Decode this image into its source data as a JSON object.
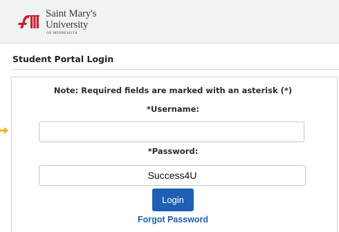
{
  "header": {
    "logo": {
      "icon": "university-crest-icon",
      "line1": "Saint Mary's",
      "line2": "University",
      "line3": "OF MINNESOTA",
      "brand_color": "#c8202f"
    }
  },
  "section": {
    "title": "Student Portal Login"
  },
  "form": {
    "note": "Note: Required fields are marked with an asterisk (*)",
    "username_label": "*Username:",
    "username_value": "",
    "password_label": "*Password:",
    "password_value": "Success4U",
    "login_label": "Login",
    "forgot_password": "Forgot Password"
  },
  "colors": {
    "header_bg": "#f1f2f3",
    "button_bg": "#1f5fb4",
    "link": "#1f5fb4",
    "pointer": "#f2b21c"
  },
  "icons": {
    "pointer": "arrow-right-icon"
  }
}
